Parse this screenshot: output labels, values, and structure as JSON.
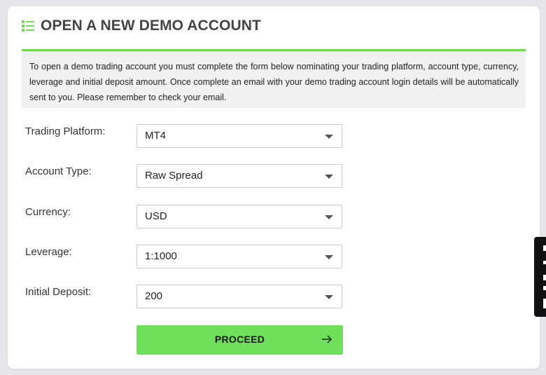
{
  "header": {
    "icon": "list-icon",
    "title": "OPEN A NEW DEMO ACCOUNT"
  },
  "info": {
    "text": "To open a demo trading account you must complete the form below nominating your trading platform, account type, currency, leverage and initial deposit amount. Once complete an email with your demo trading account login details will be automatically sent to you. Please remember to check your email."
  },
  "form": {
    "fields": [
      {
        "label": "Trading Platform:",
        "value": "MT4"
      },
      {
        "label": "Account Type:",
        "value": "Raw Spread"
      },
      {
        "label": "Currency:",
        "value": "USD"
      },
      {
        "label": "Leverage:",
        "value": "1:1000"
      },
      {
        "label": "Initial Deposit:",
        "value": "200"
      }
    ],
    "submit_label": "PROCEED"
  },
  "colors": {
    "accent": "#6fdd4f",
    "button": "#6fe05a",
    "title": "#444444"
  }
}
